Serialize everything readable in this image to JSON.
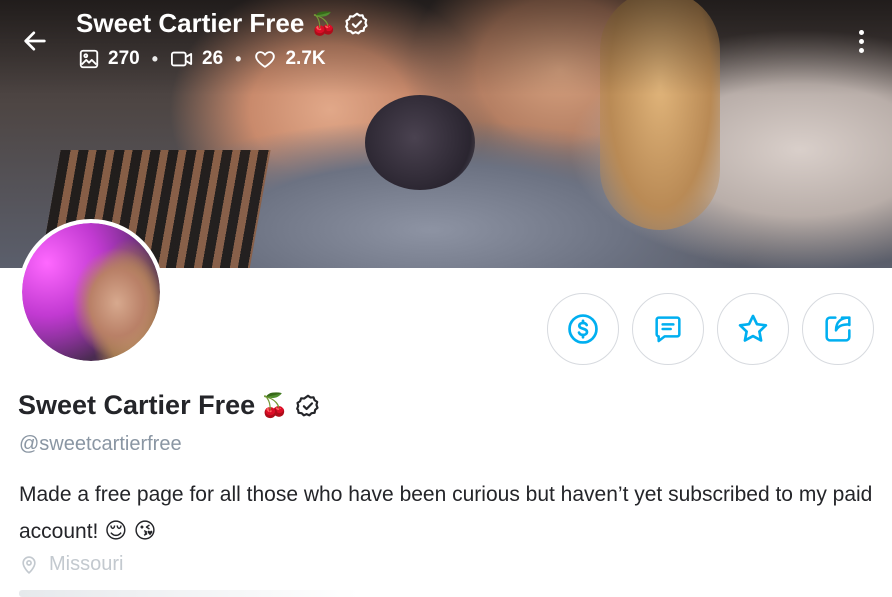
{
  "header": {
    "back_label": "Back",
    "title": "Sweet Cartier Free",
    "title_emoji": "🍒",
    "stats": {
      "photos": "270",
      "videos": "26",
      "likes": "2.7K",
      "separator": "•"
    }
  },
  "actions": [
    {
      "name": "tip",
      "icon": "dollar-circle-icon"
    },
    {
      "name": "message",
      "icon": "message-icon"
    },
    {
      "name": "favorite",
      "icon": "star-icon"
    },
    {
      "name": "share",
      "icon": "share-icon"
    }
  ],
  "profile": {
    "name": "Sweet Cartier Free",
    "name_emoji": "🍒",
    "handle": "@sweetcartierfree",
    "bio": "Made a free page for all those who have been curious but haven’t yet subscribed to my paid account!",
    "bio_emojis": "😌 😘",
    "location": "Missouri"
  },
  "colors": {
    "accent": "#00aff0",
    "text": "#242529",
    "muted": "#8a96a3",
    "border": "#d7dadf"
  }
}
